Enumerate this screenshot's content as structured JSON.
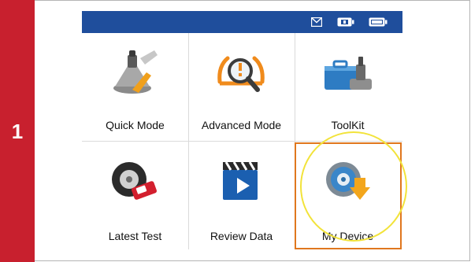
{
  "step": {
    "number": "1"
  },
  "status_bar": {
    "icons": [
      "mail-icon",
      "battery-charge-icon",
      "battery-icon"
    ]
  },
  "menu": {
    "items": [
      {
        "label": "Quick Mode",
        "icon": "valve-wrench-icon"
      },
      {
        "label": "Advanced Mode",
        "icon": "tpms-warning-search-icon"
      },
      {
        "label": "ToolKit",
        "icon": "toolbox-sensor-icon"
      },
      {
        "label": "Latest Test",
        "icon": "wheel-tool-icon"
      },
      {
        "label": "Review Data",
        "icon": "clapperboard-play-icon"
      },
      {
        "label": "My Device",
        "icon": "gear-download-icon"
      }
    ],
    "selected": "My Device"
  },
  "colors": {
    "step_bar": "#c8202e",
    "status_bar": "#1f4e9c",
    "selected_border": "#e0771e",
    "highlight_ring": "#f2e33a"
  }
}
